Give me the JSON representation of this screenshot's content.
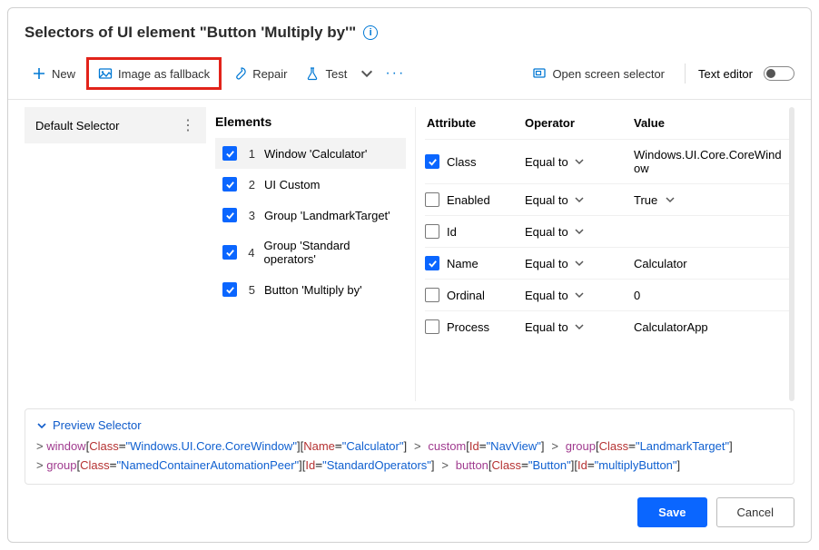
{
  "title": "Selectors of UI element \"Button 'Multiply by'\"",
  "toolbar": {
    "new": "New",
    "image_fallback": "Image as fallback",
    "repair": "Repair",
    "test": "Test",
    "open_screen_selector": "Open screen selector",
    "text_editor": "Text editor"
  },
  "sidebar": {
    "default_selector": "Default Selector"
  },
  "elements": {
    "heading": "Elements",
    "items": [
      {
        "index": "1",
        "label": "Window 'Calculator'",
        "selected": true
      },
      {
        "index": "2",
        "label": "UI Custom",
        "selected": false
      },
      {
        "index": "3",
        "label": "Group 'LandmarkTarget'",
        "selected": false
      },
      {
        "index": "4",
        "label": "Group 'Standard operators'",
        "selected": false
      },
      {
        "index": "5",
        "label": "Button 'Multiply by'",
        "selected": false
      }
    ]
  },
  "attributes": {
    "head_attr": "Attribute",
    "head_op": "Operator",
    "head_val": "Value",
    "op_equal": "Equal to",
    "rows": [
      {
        "checked": true,
        "name": "Class",
        "value": "Windows.UI.Core.CoreWindow",
        "val_chevron": false
      },
      {
        "checked": false,
        "name": "Enabled",
        "value": "True",
        "val_chevron": true
      },
      {
        "checked": false,
        "name": "Id",
        "value": "",
        "val_chevron": false
      },
      {
        "checked": true,
        "name": "Name",
        "value": "Calculator",
        "val_chevron": false
      },
      {
        "checked": false,
        "name": "Ordinal",
        "value": "0",
        "val_chevron": false
      },
      {
        "checked": false,
        "name": "Process",
        "value": "CalculatorApp",
        "val_chevron": false
      }
    ]
  },
  "preview": {
    "label": "Preview Selector",
    "segments": [
      {
        "element": "window",
        "pairs": [
          [
            "Class",
            "Windows.UI.Core.CoreWindow"
          ],
          [
            "Name",
            "Calculator"
          ]
        ]
      },
      {
        "element": "custom",
        "pairs": [
          [
            "Id",
            "NavView"
          ]
        ]
      },
      {
        "element": "group",
        "pairs": [
          [
            "Class",
            "LandmarkTarget"
          ]
        ]
      },
      {
        "element": "group",
        "pairs": [
          [
            "Class",
            "NamedContainerAutomationPeer"
          ],
          [
            "Id",
            "StandardOperators"
          ]
        ]
      },
      {
        "element": "button",
        "pairs": [
          [
            "Class",
            "Button"
          ],
          [
            "Id",
            "multiplyButton"
          ]
        ]
      }
    ]
  },
  "footer": {
    "save": "Save",
    "cancel": "Cancel"
  }
}
